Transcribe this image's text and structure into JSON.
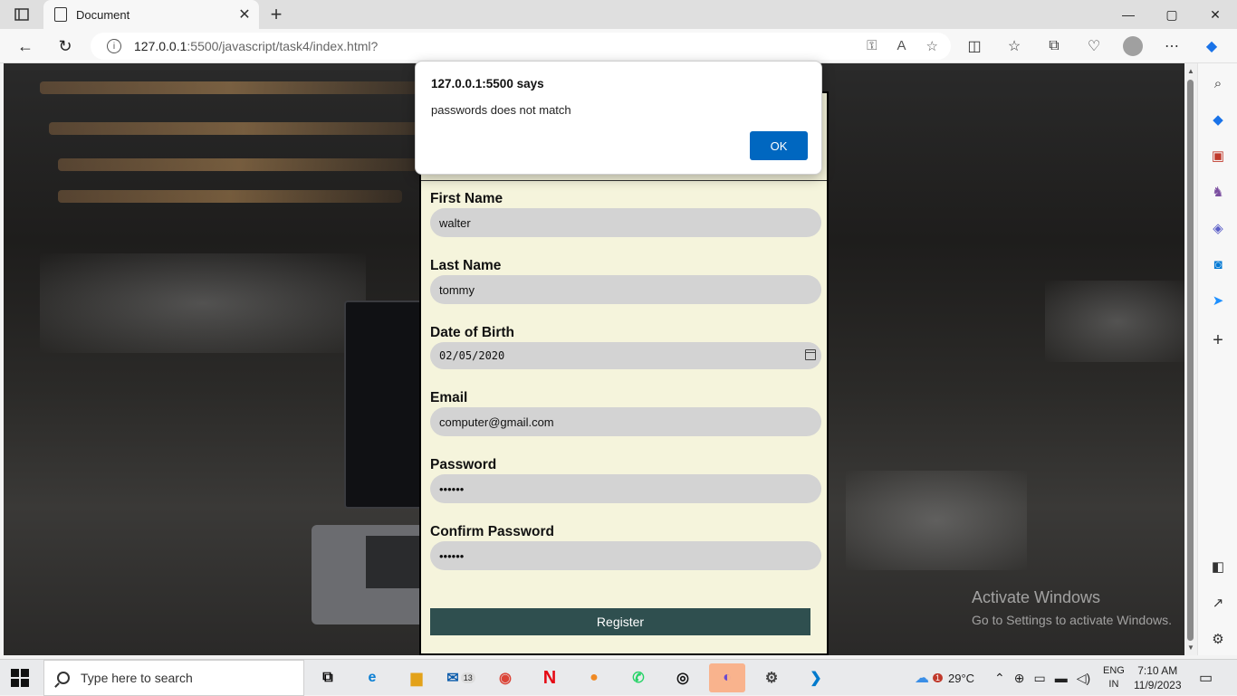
{
  "browser": {
    "tab_title": "Document",
    "tab_close": "✕",
    "new_tab": "+",
    "url_host": "127.0.0.1",
    "url_rest": ":5500/javascript/task4/index.html?",
    "window_controls": [
      "—",
      "▢",
      "✕"
    ]
  },
  "form": {
    "fields": [
      {
        "label": "First Name",
        "value": "walter"
      },
      {
        "label": "Last Name",
        "value": "tommy"
      },
      {
        "label": "Date of Birth",
        "value": "02/05/2020"
      },
      {
        "label": "Email",
        "value": "computer@gmail.com"
      },
      {
        "label": "Password",
        "value": "••••••"
      },
      {
        "label": "Confirm Password",
        "value": "••••••"
      }
    ],
    "register_label": "Register"
  },
  "alert": {
    "title": "127.0.0.1:5500 says",
    "message": "passwords does not match",
    "ok_label": "OK"
  },
  "watermark": {
    "line1": "Activate Windows",
    "line2": "Go to Settings to activate Windows."
  },
  "taskbar": {
    "search_placeholder": "Type here to search",
    "mail_badge": "13",
    "weather_temp": "29°C",
    "weather_badge": "1",
    "language": "ENG",
    "region": "IN",
    "time": "7:10 AM",
    "date": "11/9/2023"
  },
  "colors": {
    "accent": "#0067c0",
    "form_bg": "#f5f4dc",
    "register_bg": "#2f4f4f",
    "input_bg": "#d3d3d3"
  }
}
